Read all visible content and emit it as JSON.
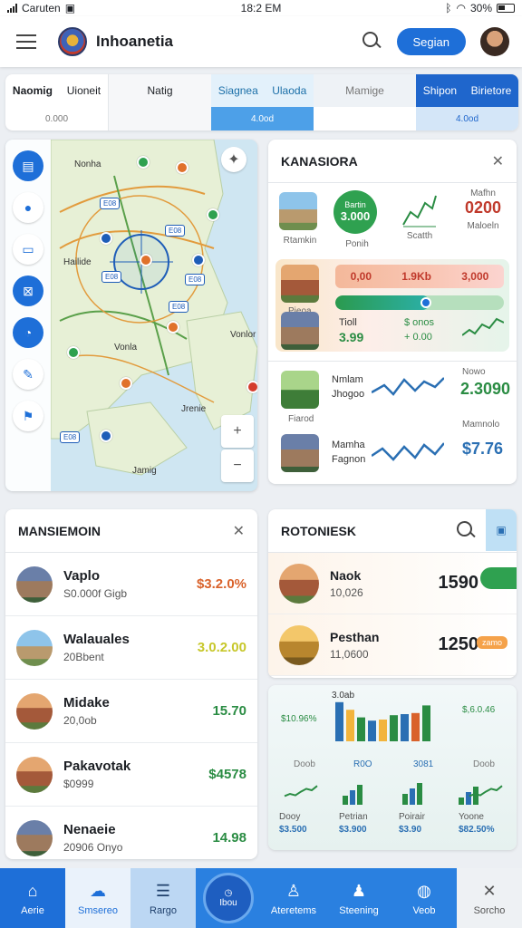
{
  "status": {
    "carrier": "Caruten",
    "time": "18:2 EM",
    "battery": "30%"
  },
  "header": {
    "title": "Inhoanetia",
    "action_label": "Segian"
  },
  "tabs": [
    {
      "top_a": "Naomig",
      "top_b": "Uioneit",
      "bottom": "0.000"
    },
    {
      "top_a": "Natig",
      "top_b": "",
      "bottom": ""
    },
    {
      "top_a": "Siagnea",
      "top_b": "Ulaoda",
      "bottom": "4.0od"
    },
    {
      "top_a": "Mamige",
      "top_b": "",
      "bottom": ""
    },
    {
      "top_a": "Shipon",
      "top_b": "Birietore",
      "bottom": "4.0od"
    }
  ],
  "map": {
    "labels": [
      "Nonha",
      "Hailide",
      "Vonla",
      "Vonlor",
      "Jrenie",
      "Jamig"
    ],
    "tags": [
      "E08",
      "E08",
      "E08",
      "E08",
      "E08",
      "E08"
    ]
  },
  "kanasiora": {
    "title": "KANASIORA",
    "row1": {
      "thumb_label": "Rtamkin",
      "circle_value": "3.000",
      "circle_label": "Bartin",
      "circle_caption": "Ponih",
      "chart_label": "Scatth",
      "stat_label": "Mafhn",
      "stat_value": "0200",
      "stat_caption": "Maloeln"
    },
    "row2": {
      "thumb_label": "Pieoa",
      "pill": [
        "0,00",
        "1.9Kb",
        "3,000"
      ],
      "progress": 0.56,
      "info_title": "Tioll",
      "info_value": "3.99",
      "info_right_a": "$ onos",
      "info_right_b": "+ 0.00"
    },
    "row3": [
      {
        "title": "Nmlam",
        "sub": "Jhogoo",
        "caption": "Fiarod",
        "stat_label": "Nowo",
        "stat_value": "2.3090"
      },
      {
        "title": "Mamha",
        "sub": "Fagnon",
        "caption": "",
        "stat_label": "Mamnolo",
        "stat_value": "$7.76"
      }
    ]
  },
  "mansiemoin": {
    "title": "MANSIEMOIN",
    "items": [
      {
        "title": "Vaplo",
        "sub": "S0.000f Gigb",
        "value": "$3.2.0%",
        "color": "#d9622b"
      },
      {
        "title": "Walauales",
        "sub": "20Bbent",
        "value": "3.0.2.00",
        "color": "#c7c72a"
      },
      {
        "title": "Midake",
        "sub": "20,0ob",
        "value": "15.70",
        "color": "#2a8c43"
      },
      {
        "title": "Pakavotak",
        "sub": "$0999",
        "value": "$4578",
        "color": "#2a8c43"
      },
      {
        "title": "Nenaeie",
        "sub": "20906 Onyo",
        "value": "14.98",
        "color": "#2a8c43"
      }
    ]
  },
  "rotoniesk": {
    "title": "ROTONIESK",
    "items": [
      {
        "title": "Naok",
        "sub": "10,026",
        "value": "1590"
      },
      {
        "title": "Pesthan",
        "sub": "11,0600",
        "value": "1250",
        "badge": "zamo"
      }
    ]
  },
  "chart_data": [
    {
      "type": "bar",
      "title": "",
      "series": [
        {
          "name": "",
          "values": [
            72,
            58,
            44,
            38,
            40,
            48,
            50,
            52,
            66
          ],
          "color": "#2a6fb3"
        }
      ],
      "labels": [
        "$10.96%",
        "3.0ab",
        "$,6.0.46",
        "Doob",
        "R0O",
        "3081",
        "Doob"
      ],
      "ylim": [
        0,
        80
      ]
    },
    {
      "type": "line",
      "series": [
        {
          "name": "",
          "values": [
            12,
            15,
            13,
            18,
            22,
            20,
            26
          ],
          "color": "#2a8c43"
        }
      ]
    }
  ],
  "charts_footer": [
    {
      "label": "Dooy",
      "value": "$3.500"
    },
    {
      "label": "Petrian",
      "value": "$3.900"
    },
    {
      "label": "Poirair",
      "value": "$3.90"
    },
    {
      "label": "Yoone",
      "value": "$82.50%"
    }
  ],
  "nav": [
    "Aerie",
    "Smsereo",
    "Rargo",
    "Ibou",
    "Ateretems",
    "Steening",
    "Veob",
    "Sorcho"
  ]
}
